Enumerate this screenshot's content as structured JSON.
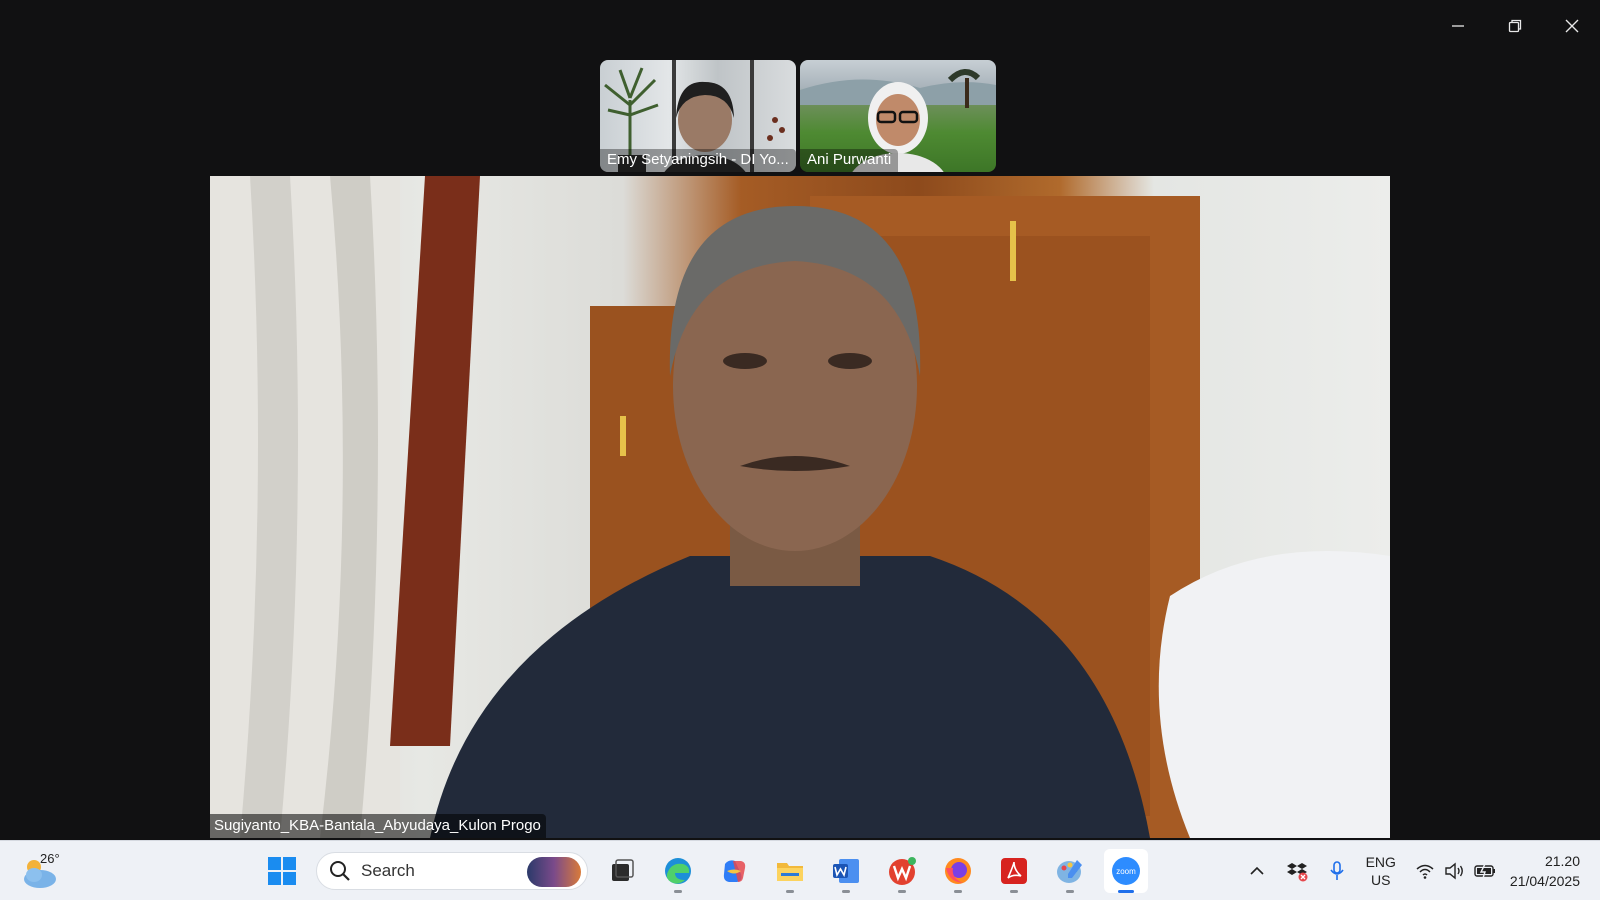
{
  "window": {
    "controls": {
      "minimize": "minimize",
      "restore": "restore",
      "close": "close"
    }
  },
  "participants": [
    {
      "name": "Emy Setyaningsih - DI Yo..."
    },
    {
      "name": "Ani Purwanti"
    }
  ],
  "main_video": {
    "speaker_name": "Sugiyanto_KBA-Bantala_Abyudaya_Kulon Progo"
  },
  "taskbar": {
    "weather": {
      "temp": "26°"
    },
    "search": {
      "placeholder": "Search"
    },
    "apps": [
      "start",
      "search",
      "task-view",
      "edge",
      "copilot",
      "file-explorer",
      "word",
      "wps-office",
      "firefox",
      "acrobat",
      "paint",
      "zoom"
    ],
    "zoom_label": "zoom",
    "tray": {
      "lang_line1": "ENG",
      "lang_line2": "US",
      "time": "21.20",
      "date": "21/04/2025"
    }
  },
  "colors": {
    "accent": "#1f6feb",
    "taskbar_bg": "#eef1f6",
    "window_bg": "#111112"
  }
}
